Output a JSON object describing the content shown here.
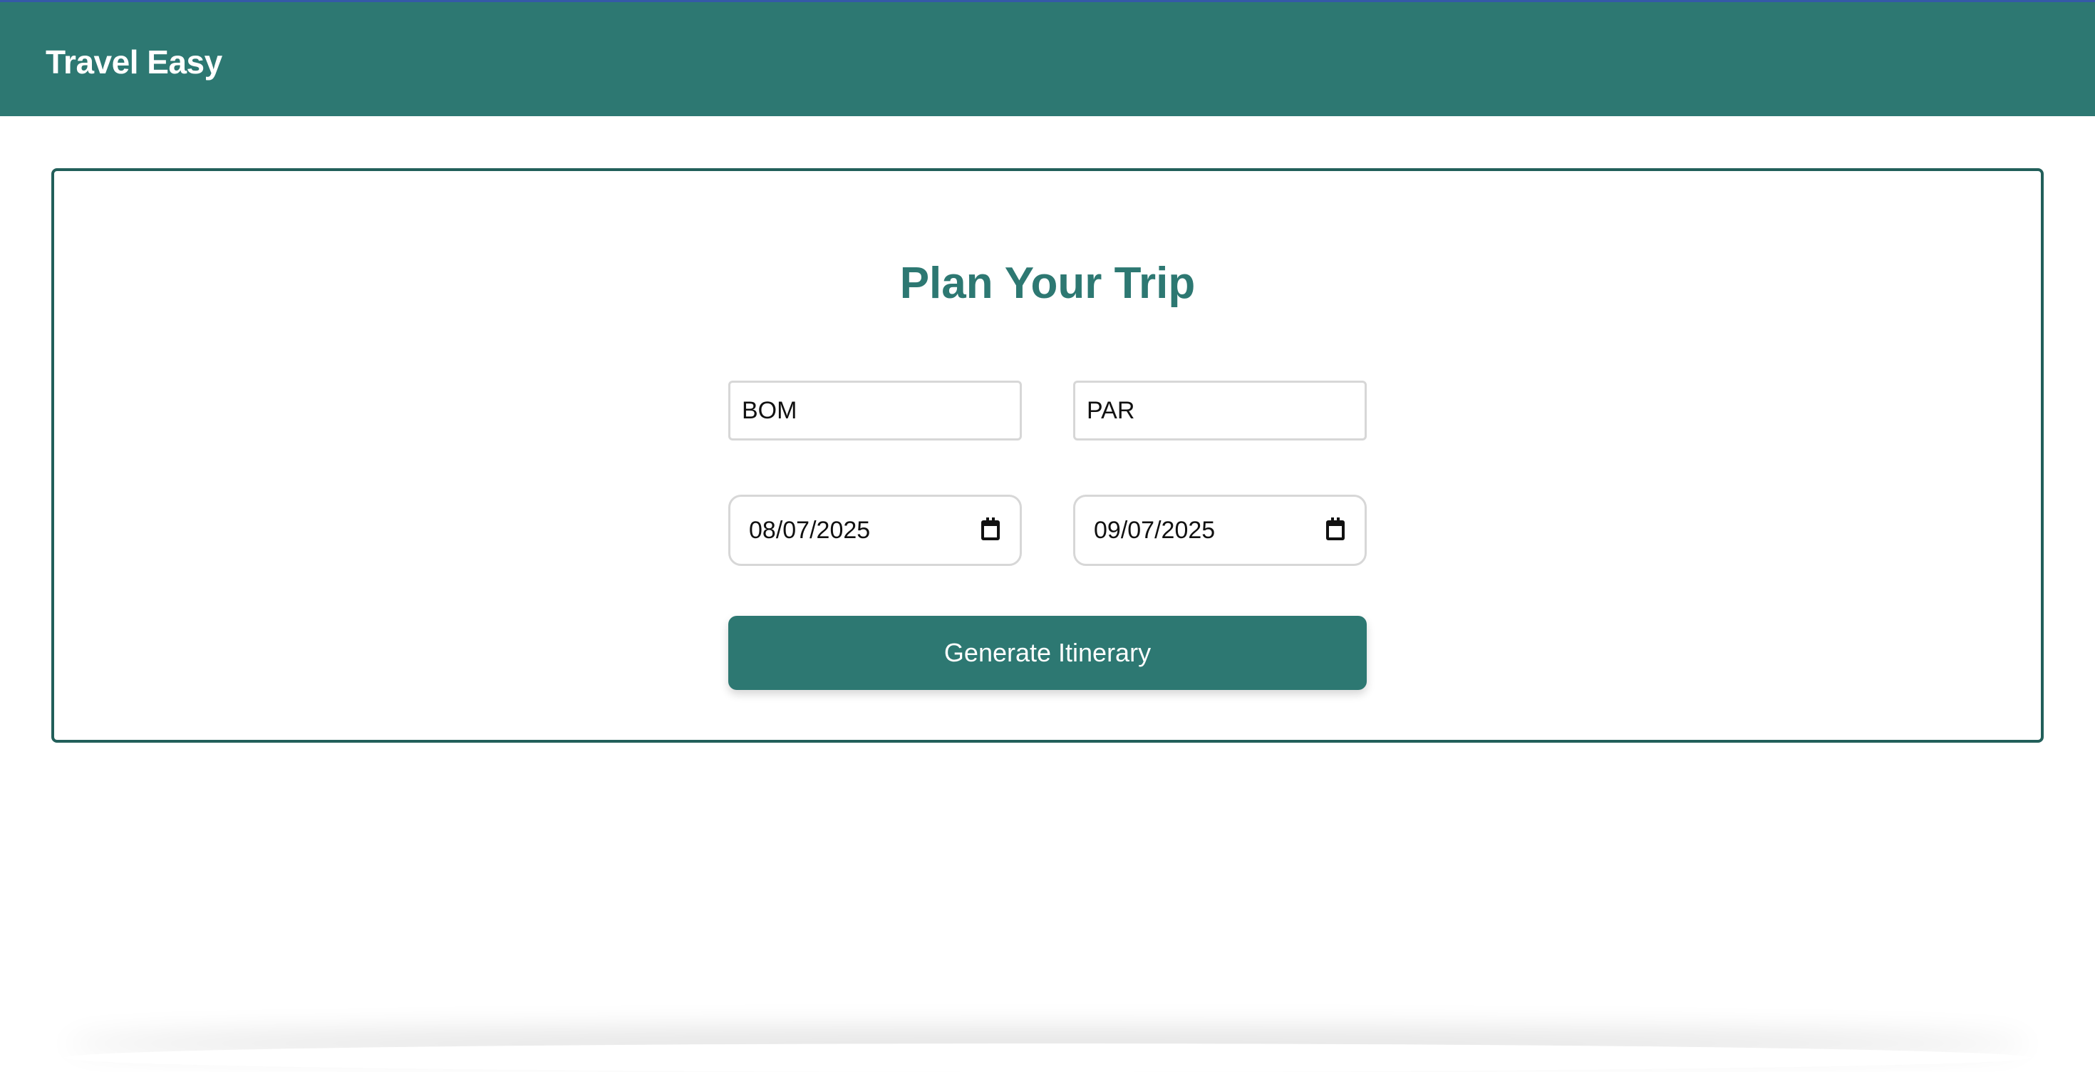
{
  "header": {
    "brand": "Travel Easy"
  },
  "main": {
    "title": "Plan Your Trip",
    "form": {
      "origin": "BOM",
      "destination": "PAR",
      "start_date": "08/07/2025",
      "end_date": "09/07/2025",
      "submit_label": "Generate Itinerary"
    }
  },
  "colors": {
    "primary": "#2d7872",
    "card_border": "#225f5a",
    "top_accent": "#3559a8"
  }
}
